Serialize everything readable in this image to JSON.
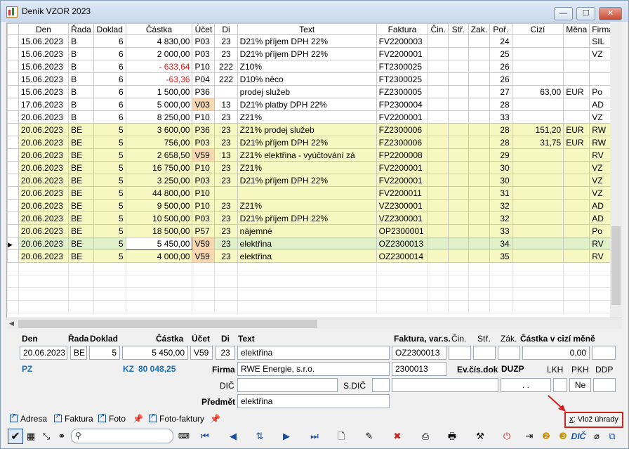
{
  "window": {
    "title": "Deník VZOR 2023",
    "controls": {
      "minimize": "—",
      "maximize": "☐",
      "close": "✕"
    }
  },
  "grid": {
    "columns": [
      "Den",
      "Řada",
      "Doklad",
      "Částka",
      "Účet",
      "Di",
      "Text",
      "Faktura",
      "Čin.",
      "Stř.",
      "Zak.",
      "Poř.",
      "Cizí",
      "Měna",
      "Firma"
    ],
    "rows": [
      {
        "den": "15.06.2023",
        "rada": "B",
        "doklad": "6",
        "castka": "4 830,00",
        "ucet": "P03",
        "di": "23",
        "text": "D21% příjem DPH 22%",
        "faktura": "FV2200003",
        "por": "24",
        "cizi": "",
        "mena": "",
        "firma": "SIL"
      },
      {
        "den": "15.06.2023",
        "rada": "B",
        "doklad": "6",
        "castka": "2 000,00",
        "ucet": "P03",
        "di": "23",
        "text": "D21% příjem DPH 22%",
        "faktura": "FV2200001",
        "por": "25",
        "cizi": "",
        "mena": "",
        "firma": "VZ"
      },
      {
        "den": "15.06.2023",
        "rada": "B",
        "doklad": "6",
        "castka": "- 633,64",
        "ucet": "P10",
        "di": "222",
        "text": "Z10%",
        "faktura": "FT2300025",
        "por": "26",
        "cizi": "",
        "mena": "",
        "firma": ""
      },
      {
        "den": "15.06.2023",
        "rada": "B",
        "doklad": "6",
        "castka": "-63,36",
        "ucet": "P04",
        "di": "222",
        "text": "D10% něco",
        "faktura": "FT2300025",
        "por": "26",
        "cizi": "",
        "mena": "",
        "firma": ""
      },
      {
        "den": "15.06.2023",
        "rada": "B",
        "doklad": "6",
        "castka": "1 500,00",
        "ucet": "P36",
        "di": "",
        "text": "prodej služeb",
        "faktura": "FZ2300005",
        "por": "27",
        "cizi": "63,00",
        "mena": "EUR",
        "firma": "Po"
      },
      {
        "den": "17.06.2023",
        "rada": "B",
        "doklad": "6",
        "castka": "5 000,00",
        "ucet": "V03",
        "di": "13",
        "text": "D21% platby DPH 22%",
        "faktura": "FP2300004",
        "por": "28",
        "cizi": "",
        "mena": "",
        "firma": "AD"
      },
      {
        "den": "20.06.2023",
        "rada": "B",
        "doklad": "6",
        "castka": "8 250,00",
        "ucet": "P10",
        "di": "23",
        "text": "Z21%",
        "faktura": "FV2200001",
        "por": "33",
        "cizi": "",
        "mena": "",
        "firma": "VZ"
      },
      {
        "den": "20.06.2023",
        "rada": "BE",
        "doklad": "5",
        "castka": "3 600,00",
        "ucet": "P36",
        "di": "23",
        "text": "Z21% prodej služeb",
        "faktura": "FZ2300006",
        "por": "28",
        "cizi": "151,20",
        "mena": "EUR",
        "firma": "RW"
      },
      {
        "den": "20.06.2023",
        "rada": "BE",
        "doklad": "5",
        "castka": "756,00",
        "ucet": "P03",
        "di": "23",
        "text": "D21% příjem DPH 22%",
        "faktura": "FZ2300006",
        "por": "28",
        "cizi": "31,75",
        "mena": "EUR",
        "firma": "RW"
      },
      {
        "den": "20.06.2023",
        "rada": "BE",
        "doklad": "5",
        "castka": "2 658,50",
        "ucet": "V59",
        "di": "13",
        "text": "Z21% elektřina - vyúčtování zá",
        "faktura": "FP2200008",
        "por": "29",
        "cizi": "",
        "mena": "",
        "firma": "RV"
      },
      {
        "den": "20.06.2023",
        "rada": "BE",
        "doklad": "5",
        "castka": "16 750,00",
        "ucet": "P10",
        "di": "23",
        "text": "Z21%",
        "faktura": "FV2200001",
        "por": "30",
        "cizi": "",
        "mena": "",
        "firma": "VZ"
      },
      {
        "den": "20.06.2023",
        "rada": "BE",
        "doklad": "5",
        "castka": "3 250,00",
        "ucet": "P03",
        "di": "23",
        "text": "D21% příjem DPH 22%",
        "faktura": "FV2200001",
        "por": "30",
        "cizi": "",
        "mena": "",
        "firma": "VZ"
      },
      {
        "den": "20.06.2023",
        "rada": "BE",
        "doklad": "5",
        "castka": "44 800,00",
        "ucet": "P10",
        "di": "",
        "text": "",
        "faktura": "FV2200011",
        "por": "31",
        "cizi": "",
        "mena": "",
        "firma": "VZ"
      },
      {
        "den": "20.06.2023",
        "rada": "BE",
        "doklad": "5",
        "castka": "9 500,00",
        "ucet": "P10",
        "di": "23",
        "text": "Z21%",
        "faktura": "VZ2300001",
        "por": "32",
        "cizi": "",
        "mena": "",
        "firma": "AD"
      },
      {
        "den": "20.06.2023",
        "rada": "BE",
        "doklad": "5",
        "castka": "10 500,00",
        "ucet": "P03",
        "di": "23",
        "text": "D21% příjem DPH 22%",
        "faktura": "VZ2300001",
        "por": "32",
        "cizi": "",
        "mena": "",
        "firma": "AD"
      },
      {
        "den": "20.06.2023",
        "rada": "BE",
        "doklad": "5",
        "castka": "18 500,00",
        "ucet": "P57",
        "di": "23",
        "text": "nájemné",
        "faktura": "OP2300001",
        "por": "33",
        "cizi": "",
        "mena": "",
        "firma": "Po"
      },
      {
        "den": "20.06.2023",
        "rada": "BE",
        "doklad": "5",
        "castka": "5 450,00",
        "ucet": "V59",
        "di": "23",
        "text": "elektřina",
        "faktura": "OZ2300013",
        "por": "34",
        "cizi": "",
        "mena": "",
        "firma": "RV"
      },
      {
        "den": "20.06.2023",
        "rada": "BE",
        "doklad": "5",
        "castka": "4 000,00",
        "ucet": "V59",
        "di": "23",
        "text": "elektřina",
        "faktura": "OZ2300014",
        "por": "35",
        "cizi": "",
        "mena": "",
        "firma": "RV"
      }
    ]
  },
  "detail": {
    "labels": {
      "den": "Den",
      "rada": "Řada",
      "doklad": "Doklad",
      "castka": "Částka",
      "ucet": "Účet",
      "di": "Di",
      "text": "Text",
      "faktura": "Faktura, var.s.",
      "cin": "Čin.",
      "str": "Stř.",
      "zak": "Zák.",
      "castka_cizi": "Částka v cizí měně",
      "firma": "Firma",
      "evcis": "Ev.čís.dok",
      "duzp": "DUZP",
      "lkh": "LKH",
      "pkh": "PKH",
      "ddp": "DDP",
      "dic": "DIČ",
      "sdic": "S.DIČ",
      "predmet": "Předmět"
    },
    "values": {
      "den": "20.06.2023",
      "rada": "BE",
      "doklad": "5",
      "castka": "5 450,00",
      "ucet": "V59",
      "di": "23",
      "text": "elektřina",
      "faktura": "OZ2300013",
      "castka_cizi": "0,00",
      "firma": "RWE Energie, s.r.o.",
      "var_s": "2300013",
      "duzp": ". .",
      "pkh": "Ne",
      "predmet": "elektřina"
    },
    "pz": "PZ",
    "kz_label": "KZ",
    "kz_value": "80 048,25"
  },
  "tabs": [
    "Adresa",
    "Faktura",
    "Foto",
    "Foto-faktury"
  ],
  "vloz_button": {
    "hotkey": "x",
    "label": ": Vlož úhrady"
  },
  "toolbar": {
    "search_placeholder": "",
    "icons": [
      "confirm-icon",
      "grid-icon",
      "expand-icon",
      "binoculars-icon",
      "search-icon",
      "keyboard-icon",
      "first-record-icon",
      "prev-record-icon",
      "sort-icon",
      "next-record-icon",
      "last-record-icon",
      "new-document-icon",
      "edit-icon",
      "delete-icon",
      "print-preview-icon",
      "print-icon",
      "tool-icon",
      "power-icon",
      "export-icon",
      "help-icon",
      "info-icon",
      "dic-icon",
      "attachment-icon",
      "network-icon"
    ],
    "dic_label": "DIČ"
  },
  "colors": {
    "yellow_row": "#f6f7c1",
    "selected_row": "#dff0c8",
    "negative": "#e21b1b",
    "account_highlight": "#f8d8b0",
    "accent_blue": "#1a6fb8",
    "annotation_red": "#d0211c"
  }
}
